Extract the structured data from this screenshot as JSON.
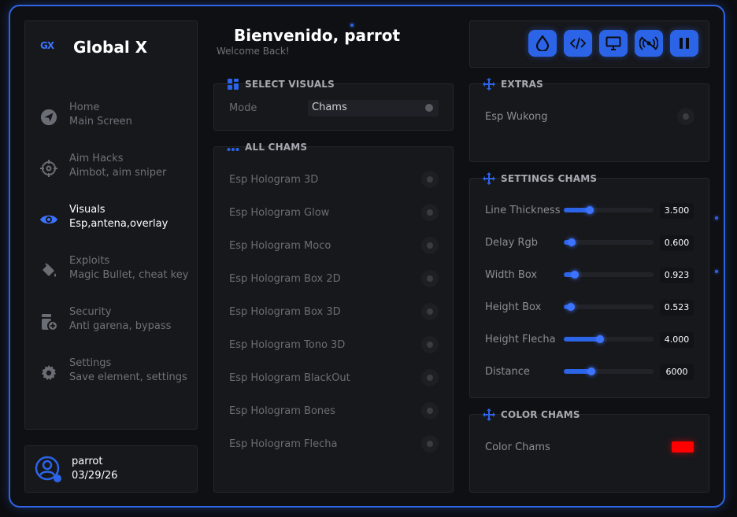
{
  "brand": {
    "logo": "GX",
    "name": "Global X"
  },
  "nav": [
    {
      "title": "Home",
      "sub": "Main Screen",
      "icon": "send-icon",
      "active": false
    },
    {
      "title": "Aim Hacks",
      "sub": "Aimbot, aim sniper",
      "icon": "crosshair-icon",
      "active": false
    },
    {
      "title": "Visuals",
      "sub": "Esp,antena,overlay",
      "icon": "eye-icon",
      "active": true
    },
    {
      "title": "Exploits",
      "sub": "Magic Bullet, cheat key",
      "icon": "paint-bucket-icon",
      "active": false
    },
    {
      "title": "Security",
      "sub": "Anti garena, bypass",
      "icon": "shield-settings-icon",
      "active": false
    },
    {
      "title": "Settings",
      "sub": "Save element, settings",
      "icon": "gear-icon",
      "active": false
    }
  ],
  "user": {
    "name": "parrot",
    "date": "03/29/26"
  },
  "header": {
    "title": "Bienvenido, parrot",
    "subtitle": "Welcome Back!"
  },
  "toolbar": [
    "drop-icon",
    "code-icon",
    "monitor-icon",
    "broadcast-icon",
    "pause-icon"
  ],
  "select_visuals": {
    "title": "SELECT VISUALS",
    "label": "Mode",
    "value": "Chams"
  },
  "all_chams": {
    "title": "ALL CHAMS",
    "items": [
      "Esp Hologram 3D",
      "Esp Hologram Glow",
      "Esp Hologram Moco",
      "Esp Hologram Box 2D",
      "Esp Hologram Box 3D",
      "Esp Hologram Tono 3D",
      "Esp Hologram BlackOut",
      "Esp Hologram Bones",
      "Esp Hologram Flecha"
    ]
  },
  "extras": {
    "title": "EXTRAS",
    "items": [
      "Esp Wukong"
    ]
  },
  "settings_chams": {
    "title": "SETTINGS CHAMS",
    "sliders": [
      {
        "label": "Line Thickness",
        "value": "3.500",
        "fraction": 0.29
      },
      {
        "label": "Delay Rgb",
        "value": "0.600",
        "fraction": 0.09
      },
      {
        "label": "Width Box",
        "value": "0.923",
        "fraction": 0.12
      },
      {
        "label": "Height Box",
        "value": "0.523",
        "fraction": 0.08
      },
      {
        "label": "Height Flecha",
        "value": "4.000",
        "fraction": 0.4
      },
      {
        "label": "Distance",
        "value": "6000",
        "fraction": 0.31
      }
    ]
  },
  "color_chams": {
    "title": "COLOR CHAMS",
    "label": "Color Chams",
    "color": "#ff0000"
  },
  "colors": {
    "accent": "#2c64e8",
    "border": "#2f64e4"
  }
}
